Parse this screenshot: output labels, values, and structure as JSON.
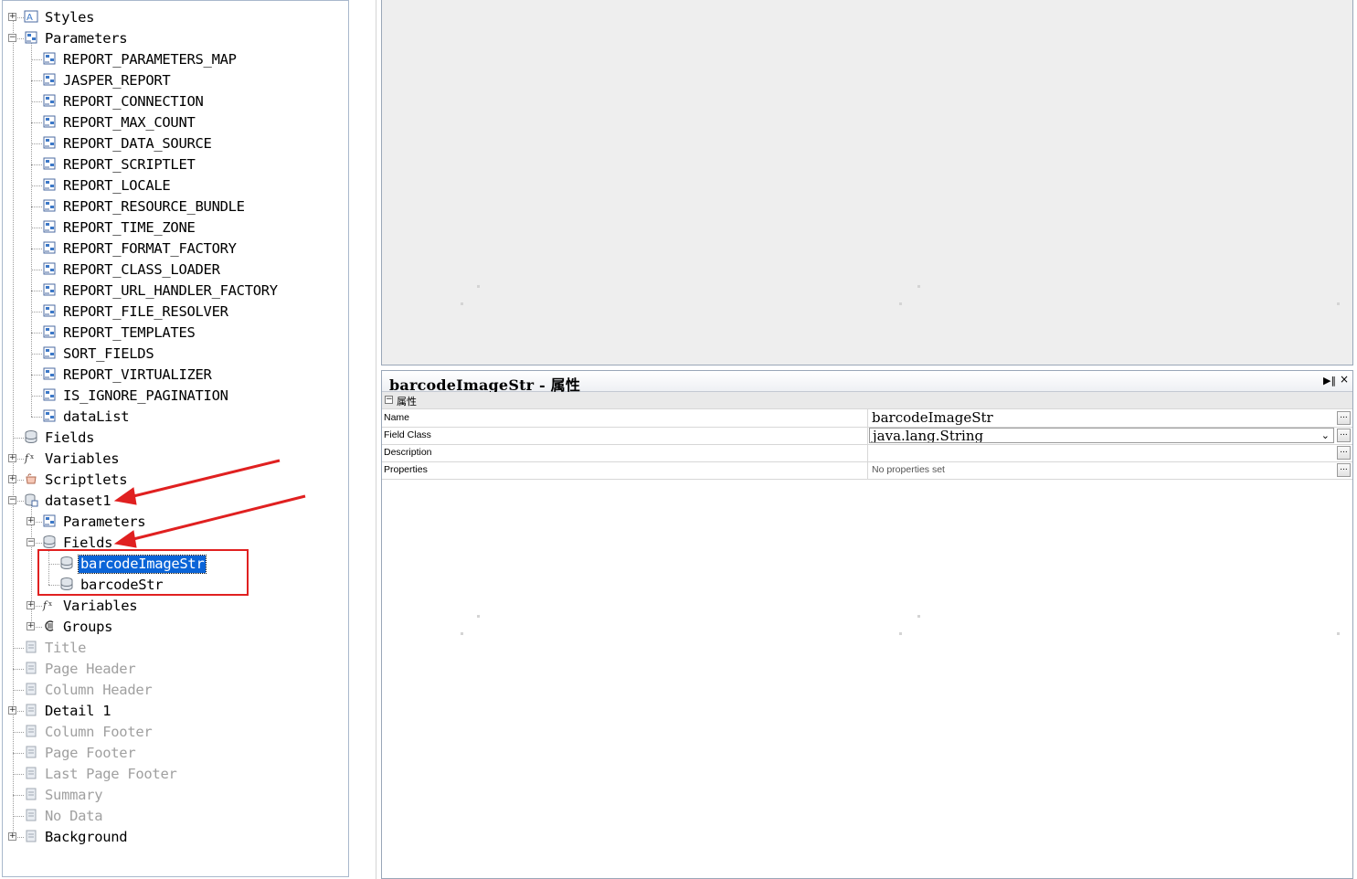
{
  "tree": {
    "clipped_top": "",
    "items": [
      {
        "label": "Styles",
        "icon": "styles-icon",
        "dim": false,
        "sel": false,
        "expander": "+"
      },
      {
        "label": "Parameters",
        "icon": "parameter-icon",
        "dim": false,
        "sel": false,
        "expander": "-"
      },
      {
        "label": "REPORT_PARAMETERS_MAP",
        "icon": "parameter-icon"
      },
      {
        "label": "JASPER_REPORT",
        "icon": "parameter-icon"
      },
      {
        "label": "REPORT_CONNECTION",
        "icon": "parameter-icon"
      },
      {
        "label": "REPORT_MAX_COUNT",
        "icon": "parameter-icon"
      },
      {
        "label": "REPORT_DATA_SOURCE",
        "icon": "parameter-icon"
      },
      {
        "label": "REPORT_SCRIPTLET",
        "icon": "parameter-icon"
      },
      {
        "label": "REPORT_LOCALE",
        "icon": "parameter-icon"
      },
      {
        "label": "REPORT_RESOURCE_BUNDLE",
        "icon": "parameter-icon"
      },
      {
        "label": "REPORT_TIME_ZONE",
        "icon": "parameter-icon"
      },
      {
        "label": "REPORT_FORMAT_FACTORY",
        "icon": "parameter-icon"
      },
      {
        "label": "REPORT_CLASS_LOADER",
        "icon": "parameter-icon"
      },
      {
        "label": "REPORT_URL_HANDLER_FACTORY",
        "icon": "parameter-icon"
      },
      {
        "label": "REPORT_FILE_RESOLVER",
        "icon": "parameter-icon"
      },
      {
        "label": "REPORT_TEMPLATES",
        "icon": "parameter-icon"
      },
      {
        "label": "SORT_FIELDS",
        "icon": "parameter-icon"
      },
      {
        "label": "REPORT_VIRTUALIZER",
        "icon": "parameter-icon"
      },
      {
        "label": "IS_IGNORE_PAGINATION",
        "icon": "parameter-icon"
      },
      {
        "label": "dataList",
        "icon": "parameter-icon"
      },
      {
        "label": "Fields",
        "icon": "field-icon"
      },
      {
        "label": "Variables",
        "icon": "variable-icon",
        "expander": "+"
      },
      {
        "label": "Scriptlets",
        "icon": "scriptlet-icon",
        "expander": "+"
      },
      {
        "label": "dataset1",
        "icon": "dataset-icon",
        "expander": "-"
      },
      {
        "label": "Parameters",
        "icon": "parameter-icon",
        "expander": "+"
      },
      {
        "label": "Fields",
        "icon": "field-icon",
        "expander": "-"
      },
      {
        "label": "barcodeImageStr",
        "icon": "field-icon",
        "sel": true
      },
      {
        "label": "barcodeStr",
        "icon": "field-icon"
      },
      {
        "label": "Variables",
        "icon": "variable-icon",
        "expander": "+"
      },
      {
        "label": "Groups",
        "icon": "group-icon",
        "expander": "+"
      },
      {
        "label": "Title",
        "icon": "band-icon",
        "dim": true
      },
      {
        "label": "Page Header",
        "icon": "band-icon",
        "dim": true
      },
      {
        "label": "Column Header",
        "icon": "band-icon",
        "dim": true
      },
      {
        "label": "Detail 1",
        "icon": "band-icon",
        "expander": "+"
      },
      {
        "label": "Column Footer",
        "icon": "band-icon",
        "dim": true
      },
      {
        "label": "Page Footer",
        "icon": "band-icon",
        "dim": true
      },
      {
        "label": "Last Page Footer",
        "icon": "band-icon",
        "dim": true
      },
      {
        "label": "Summary",
        "icon": "band-icon",
        "dim": true
      },
      {
        "label": "No Data",
        "icon": "band-icon",
        "dim": true
      },
      {
        "label": "Background",
        "icon": "band-icon",
        "expander": "+"
      }
    ]
  },
  "properties": {
    "title": "barcodeImageStr - 属性",
    "category": "属性",
    "rows": {
      "name": {
        "label": "Name",
        "value": "barcodeImageStr"
      },
      "field_class": {
        "label": "Field Class",
        "value": "java.lang.String"
      },
      "description": {
        "label": "Description",
        "value": ""
      },
      "properties": {
        "label": "Properties",
        "value": "No properties set"
      }
    },
    "ellipsis": "..."
  },
  "colors": {
    "selection": "#0a64d8",
    "annotation": "#e02020",
    "canvas": "#eeeeee"
  }
}
